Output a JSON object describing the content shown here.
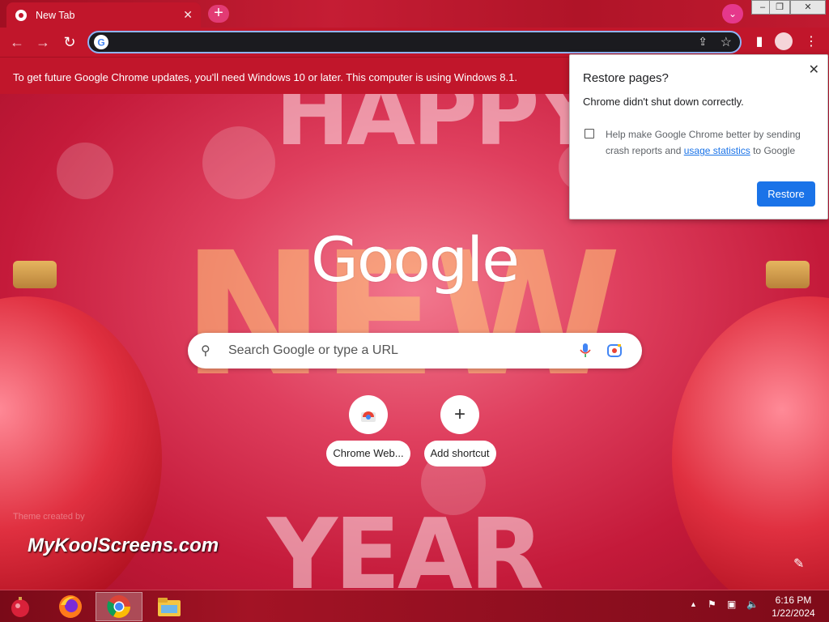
{
  "browser": {
    "tab_title": "New Tab",
    "tab_close": "✕",
    "new_tab": "+"
  },
  "window_controls": {
    "minimize": "–",
    "maximize": "❐",
    "close": "✕"
  },
  "toolbar": {
    "back": "←",
    "forward": "→",
    "reload": "↻"
  },
  "omnibox": {
    "value": ""
  },
  "infobar": {
    "message": "To get future Google Chrome updates, you'll need Windows 10 or later. This computer is using Windows 8.1."
  },
  "ntp": {
    "logo": "Google",
    "search_placeholder": "Search Google or type a URL",
    "shortcuts": [
      {
        "label": "Chrome Web...",
        "icon": "chrome-web-store-icon"
      },
      {
        "label": "Add shortcut",
        "icon": "plus-icon",
        "glyph": "+"
      }
    ],
    "theme_attribution": "Theme created by",
    "watermark": "MyKoolScreens.com",
    "background_words": [
      "HAPPY",
      "NEW",
      "YEAR"
    ]
  },
  "restore_popup": {
    "title": "Restore pages?",
    "message": "Chrome didn't shut down correctly.",
    "checkbox_text_before": "Help make Google Chrome better by sending crash reports and ",
    "checkbox_link": "usage statistics",
    "checkbox_text_after": " to Google",
    "checkbox_checked": false,
    "restore_button": "Restore",
    "close": "✕"
  },
  "taskbar": {
    "apps": [
      "firefox-icon",
      "chrome-icon",
      "file-explorer-icon"
    ],
    "active_app": "chrome-icon",
    "time": "6:16 PM",
    "date": "1/22/2024"
  },
  "colors": {
    "accent": "#c1162b",
    "button_blue": "#1a73e8"
  }
}
